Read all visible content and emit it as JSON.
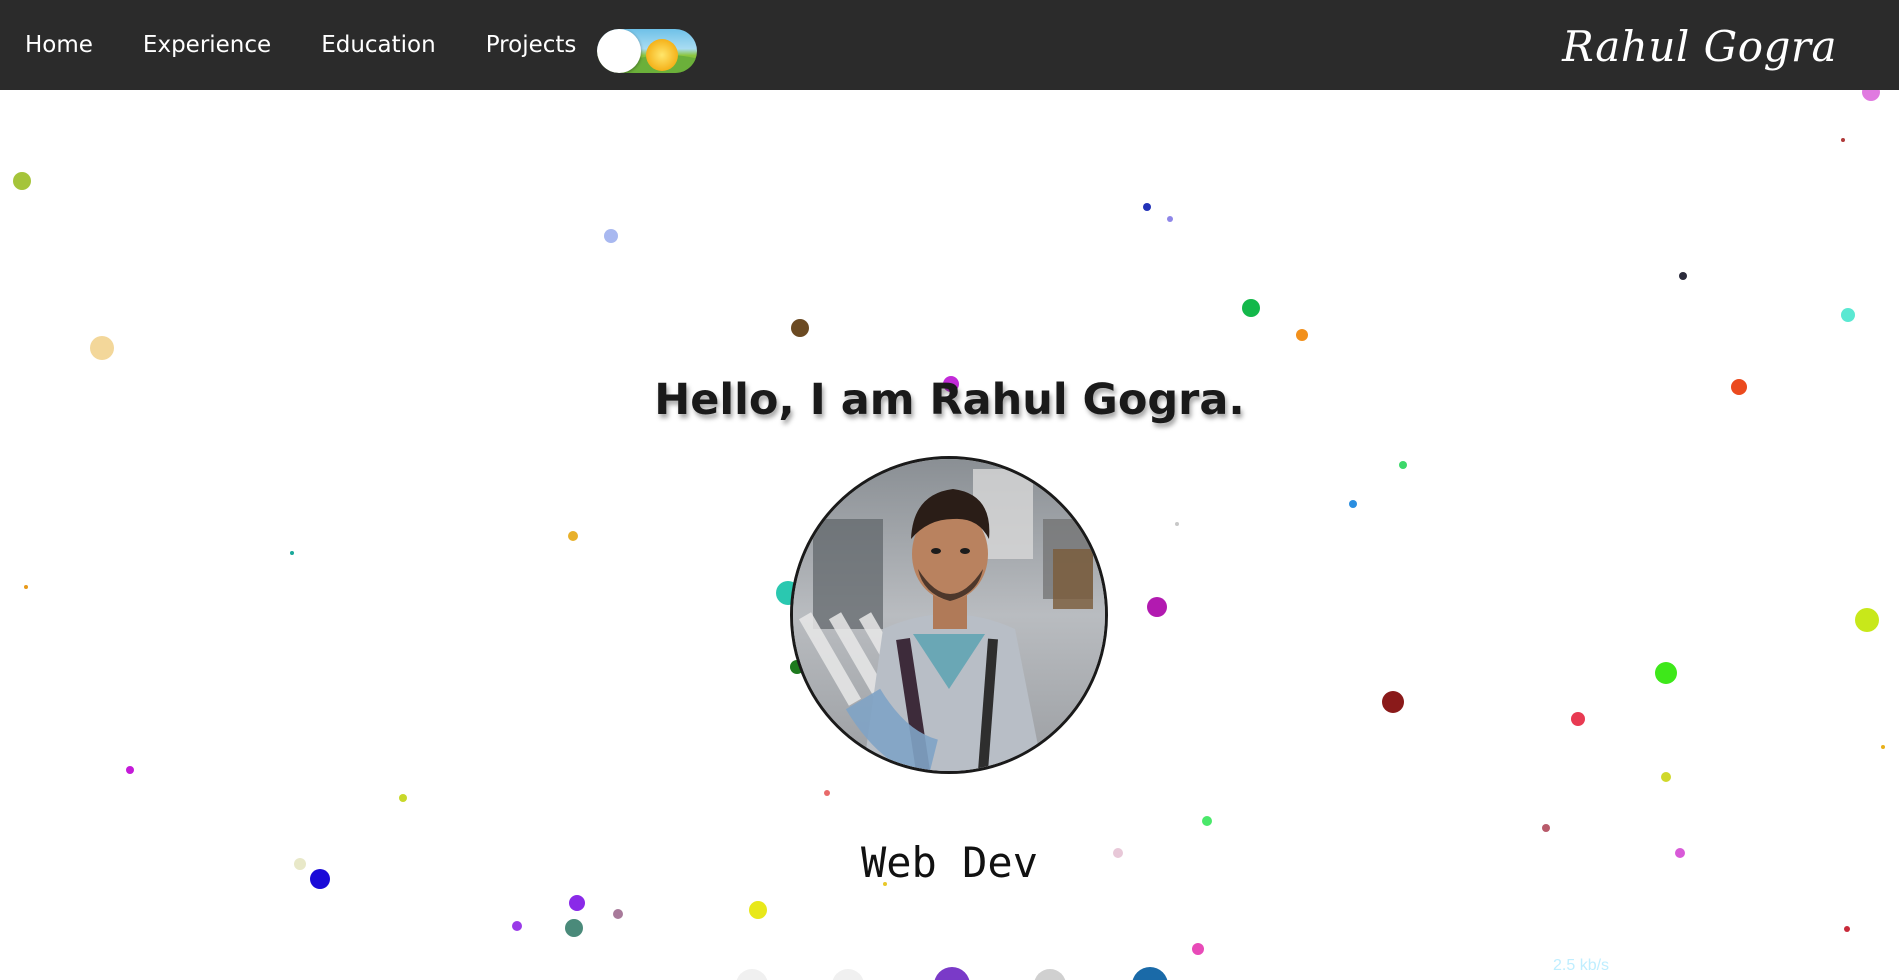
{
  "nav": {
    "links": [
      "Home",
      "Experience",
      "Education",
      "Projects"
    ],
    "brand": "Rahul Gogra",
    "theme_toggle_state": "light"
  },
  "hero": {
    "title": "Hello, I am Rahul Gogra.",
    "role": "Web Dev"
  },
  "overlay": {
    "net_speed": "2.5 kb/s"
  },
  "colors": {
    "navbar_bg": "#2b2b2b",
    "page_bg": "#ffffff",
    "text_dark": "#1a1a1a"
  },
  "icons": [
    "sun-toggle-icon",
    "avatar-photo"
  ]
}
